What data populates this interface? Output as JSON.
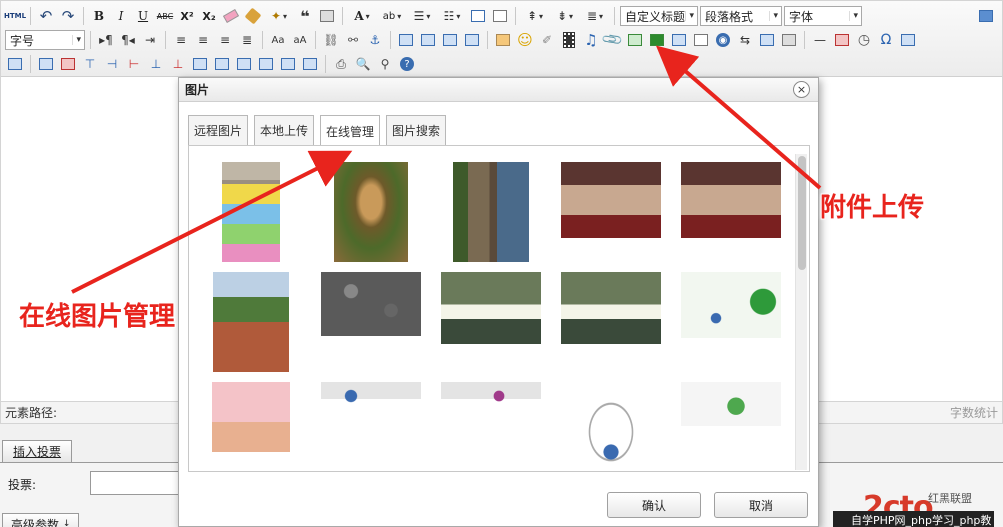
{
  "toolbar": {
    "row1_buttons": [
      {
        "name": "html-source-button",
        "glyph": "HTML"
      },
      {
        "name": "undo-button",
        "glyph": "↶"
      },
      {
        "name": "redo-button",
        "glyph": "↷"
      },
      {
        "name": "bold-button",
        "glyph": "B"
      },
      {
        "name": "italic-button",
        "glyph": "I"
      },
      {
        "name": "underline-button",
        "glyph": "U"
      },
      {
        "name": "strikethrough-button",
        "glyph": "ABC"
      },
      {
        "name": "superscript-button",
        "glyph": "X²"
      },
      {
        "name": "subscript-button",
        "glyph": "X₂"
      },
      {
        "name": "clear-format-button",
        "glyph": "⌫"
      },
      {
        "name": "format-painter-button",
        "glyph": "🖌"
      },
      {
        "name": "auto-format-button",
        "glyph": "✎"
      },
      {
        "name": "blockquote-button",
        "glyph": "❝"
      },
      {
        "name": "paste-plain-button",
        "glyph": "📋"
      },
      {
        "name": "font-color-button",
        "glyph": "A"
      },
      {
        "name": "background-color-button",
        "glyph": "ab"
      },
      {
        "name": "ordered-list-button",
        "glyph": "⒈"
      },
      {
        "name": "unordered-list-button",
        "glyph": "•"
      },
      {
        "name": "select-all-button",
        "glyph": "▣"
      },
      {
        "name": "clear-doc-button",
        "glyph": "▢"
      },
      {
        "name": "row-spacing-top-button",
        "glyph": "⇡"
      },
      {
        "name": "row-spacing-bottom-button",
        "glyph": "⇣"
      },
      {
        "name": "line-height-button",
        "glyph": "≡"
      }
    ],
    "paragraph_select": "自定义标题",
    "heading_select": "段落格式",
    "font_family_select": "字体",
    "font_size_select": "字号",
    "fullscreen_icon": "fullscreen-icon"
  },
  "editor": {
    "element_path_label": "元素路径:",
    "word_count_label": "字数统计"
  },
  "dialog": {
    "title": "图片",
    "close_glyph": "×",
    "tabs": [
      "远程图片",
      "本地上传",
      "在线管理",
      "图片搜索"
    ],
    "active_tab": "在线管理",
    "ok_label": "确认",
    "cancel_label": "取消",
    "images": [
      {
        "name": "thumb-cats-stack",
        "desc": "cats stacked in colored boxes"
      },
      {
        "name": "thumb-wood-carving",
        "desc": "wooden tree carving"
      },
      {
        "name": "thumb-tree-trunk",
        "desc": "tree trunk in city"
      },
      {
        "name": "thumb-room-1",
        "desc": "interior room"
      },
      {
        "name": "thumb-room-2",
        "desc": "interior room"
      },
      {
        "name": "thumb-pine-tree",
        "desc": "pine tree on red rock"
      },
      {
        "name": "thumb-pebbles",
        "desc": "gray pebbles field"
      },
      {
        "name": "thumb-eggs-aerial-1",
        "desc": "fried-egg sculptures aerial"
      },
      {
        "name": "thumb-eggs-aerial-2",
        "desc": "fried-egg sculptures aerial"
      },
      {
        "name": "thumb-bracelet-clover",
        "desc": "bracelet with clover"
      },
      {
        "name": "thumb-holding-hands",
        "desc": "holding hands"
      },
      {
        "name": "thumb-bracelet-blue",
        "desc": "bracelet blue flower"
      },
      {
        "name": "thumb-bracelet-purple",
        "desc": "bracelet purple flower"
      },
      {
        "name": "thumb-bracelet-blue-2",
        "desc": "bracelet blue flower"
      },
      {
        "name": "thumb-bracelet-green",
        "desc": "bracelet green clover"
      }
    ]
  },
  "form": {
    "vote_tab_label": "插入投票",
    "vote_label": "投票:",
    "advanced_label": "高级参数"
  },
  "annotations": {
    "online_images": "在线图片管理",
    "attachment_upload": "附件上传"
  },
  "watermark": {
    "logo_text": "2cto",
    "sub_text": "红黑联盟",
    "bottom_text": "自学PHP网_php学习_php教"
  }
}
